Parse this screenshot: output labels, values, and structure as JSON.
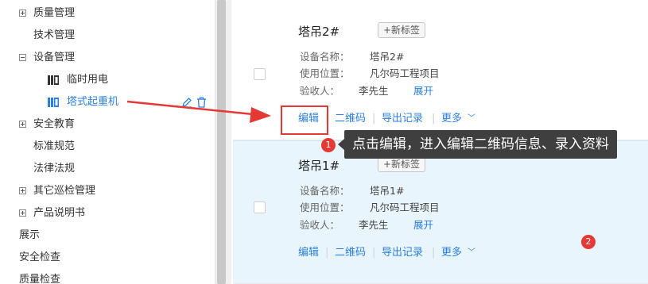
{
  "sidebar": {
    "items": [
      {
        "label": "质量管理",
        "expander": "plus"
      },
      {
        "label": "技术管理"
      },
      {
        "label": "设备管理",
        "expander": "minus"
      },
      {
        "label": "临时用电",
        "icon": "device-icon"
      },
      {
        "label": "塔式起重机",
        "icon": "device-icon",
        "selected": true
      },
      {
        "label": "安全教育",
        "expander": "plus"
      },
      {
        "label": "标准规范"
      },
      {
        "label": "法律法规"
      },
      {
        "label": "其它巡检管理",
        "expander": "plus"
      },
      {
        "label": "产品说明书",
        "expander": "plus"
      },
      {
        "label": "展示"
      },
      {
        "label": "安全检查"
      },
      {
        "label": "质量检查"
      }
    ],
    "selected_actions": {
      "edit_icon": "pencil-icon",
      "delete_icon": "trash-icon"
    }
  },
  "cards": [
    {
      "title": "塔吊2#",
      "tag_button": "+新标签",
      "fields": [
        {
          "label": "设备名称：",
          "value": "塔吊2#"
        },
        {
          "label": "使用位置：",
          "value": "凡尔码工程项目"
        },
        {
          "label": "验收人：",
          "value": "李先生",
          "expand": "展开"
        }
      ],
      "actions": [
        "编辑",
        "二维码",
        "导出记录",
        "更多"
      ]
    },
    {
      "title": "塔吊1#",
      "tag_button": "+新标签",
      "fields": [
        {
          "label": "设备名称：",
          "value": "塔吊1#"
        },
        {
          "label": "使用位置：",
          "value": "凡尔码工程项目"
        },
        {
          "label": "验收人：",
          "value": "李先生",
          "expand": "展开"
        }
      ],
      "actions": [
        "编辑",
        "二维码",
        "导出记录",
        "更多"
      ]
    }
  ],
  "annotations": {
    "tooltip": "点击编辑，进入编辑二维码信息、录入资料",
    "badge1": "1",
    "badge2": "2"
  },
  "colors": {
    "accent": "#2a7fe0",
    "highlight": "#e53935",
    "selected_card_bg": "#e9f5fc",
    "tooltip_bg": "#3f3f3f"
  }
}
